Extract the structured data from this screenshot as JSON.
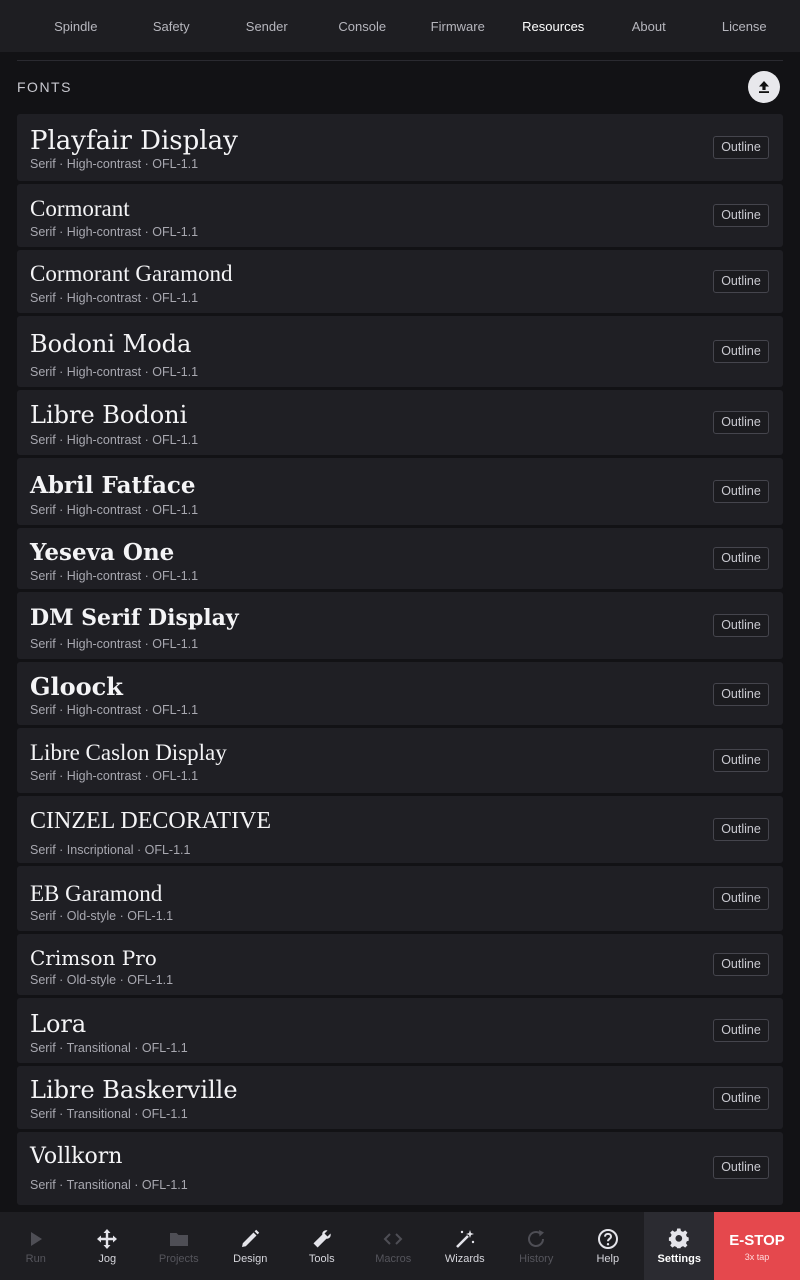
{
  "top_tabs": [
    {
      "label": "Spindle",
      "active": false
    },
    {
      "label": "Safety",
      "active": false
    },
    {
      "label": "Sender",
      "active": false
    },
    {
      "label": "Console",
      "active": false
    },
    {
      "label": "Firmware",
      "active": false
    },
    {
      "label": "Resources",
      "active": true
    },
    {
      "label": "About",
      "active": false
    },
    {
      "label": "License",
      "active": false
    }
  ],
  "section": {
    "title": "FONTS",
    "upload_icon": "upload-icon"
  },
  "fonts": [
    {
      "name": "Playfair Display",
      "meta": "Serif · High-contrast · OFL-1.1",
      "button": "Outline"
    },
    {
      "name": "Cormorant",
      "meta": "Serif · High-contrast · OFL-1.1",
      "button": "Outline"
    },
    {
      "name": "Cormorant Garamond",
      "meta": "Serif · High-contrast · OFL-1.1",
      "button": "Outline"
    },
    {
      "name": "Bodoni Moda",
      "meta": "Serif · High-contrast · OFL-1.1",
      "button": "Outline"
    },
    {
      "name": "Libre Bodoni",
      "meta": "Serif · High-contrast · OFL-1.1",
      "button": "Outline"
    },
    {
      "name": "Abril Fatface",
      "meta": "Serif · High-contrast · OFL-1.1",
      "button": "Outline"
    },
    {
      "name": "Yeseva One",
      "meta": "Serif · High-contrast · OFL-1.1",
      "button": "Outline"
    },
    {
      "name": "DM Serif Display",
      "meta": "Serif · High-contrast · OFL-1.1",
      "button": "Outline"
    },
    {
      "name": "Gloock",
      "meta": "Serif · High-contrast · OFL-1.1",
      "button": "Outline"
    },
    {
      "name": "Libre Caslon Display",
      "meta": "Serif · High-contrast · OFL-1.1",
      "button": "Outline"
    },
    {
      "name": "CINZEL DECORATIVE",
      "meta": "Serif · Inscriptional · OFL-1.1",
      "button": "Outline"
    },
    {
      "name": "EB Garamond",
      "meta": "Serif · Old-style · OFL-1.1",
      "button": "Outline"
    },
    {
      "name": "Crimson Pro",
      "meta": "Serif · Old-style · OFL-1.1",
      "button": "Outline"
    },
    {
      "name": "Lora",
      "meta": "Serif · Transitional · OFL-1.1",
      "button": "Outline"
    },
    {
      "name": "Libre Baskerville",
      "meta": "Serif · Transitional · OFL-1.1",
      "button": "Outline"
    },
    {
      "name": "Vollkorn",
      "meta": "Serif · Transitional · OFL-1.1",
      "button": "Outline"
    }
  ],
  "bottom_nav": [
    {
      "label": "Run",
      "icon": "play-icon",
      "enabled": false,
      "active": false
    },
    {
      "label": "Jog",
      "icon": "move-arrows-icon",
      "enabled": true,
      "active": false
    },
    {
      "label": "Projects",
      "icon": "folder-icon",
      "enabled": false,
      "active": false
    },
    {
      "label": "Design",
      "icon": "pencil-icon",
      "enabled": true,
      "active": false
    },
    {
      "label": "Tools",
      "icon": "wrench-icon",
      "enabled": true,
      "active": false
    },
    {
      "label": "Macros",
      "icon": "code-icon",
      "enabled": false,
      "active": false
    },
    {
      "label": "Wizards",
      "icon": "magic-wand-icon",
      "enabled": true,
      "active": false
    },
    {
      "label": "History",
      "icon": "refresh-icon",
      "enabled": false,
      "active": false
    },
    {
      "label": "Help",
      "icon": "help-circle-icon",
      "enabled": true,
      "active": false
    },
    {
      "label": "Settings",
      "icon": "gear-icon",
      "enabled": true,
      "active": true
    }
  ],
  "estop": {
    "label": "E-STOP",
    "sublabel": "3x tap"
  },
  "colors": {
    "background": "#121215",
    "bar": "#1e1e22",
    "card": "#1f1f24",
    "estop": "#e5484d"
  }
}
